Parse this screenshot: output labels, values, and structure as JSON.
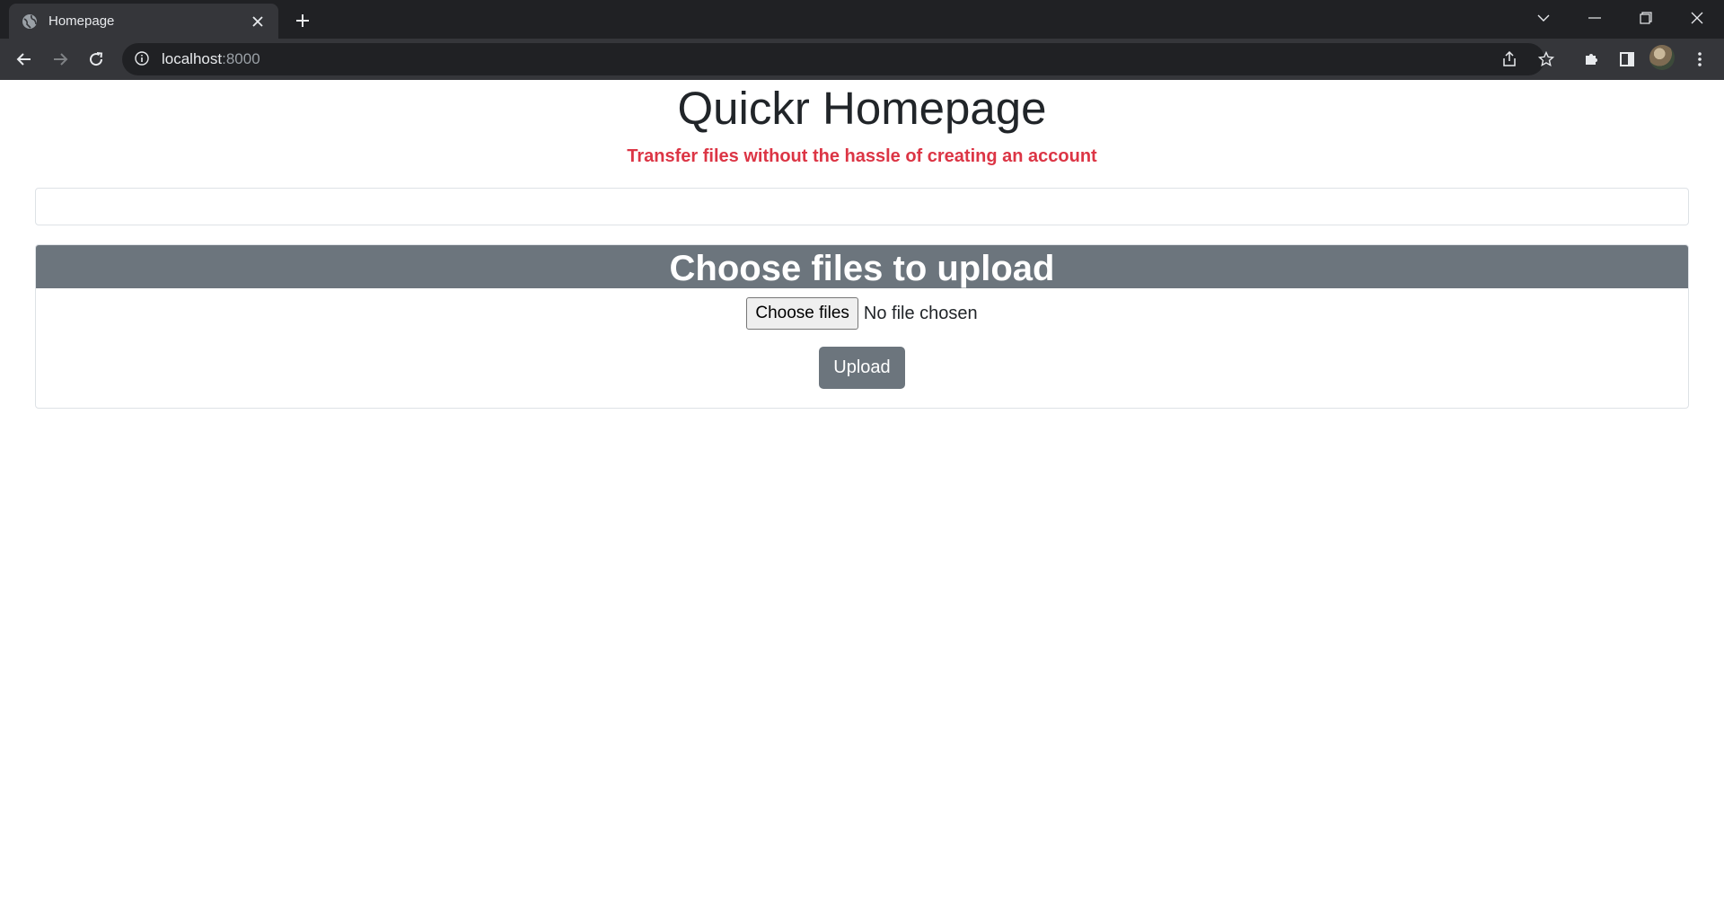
{
  "browser": {
    "tab": {
      "title": "Homepage"
    },
    "url": {
      "host": "localhost",
      "port": ":8000"
    }
  },
  "page": {
    "title": "Quickr Homepage",
    "subtitle": "Transfer files without the hassle of creating an account",
    "upload_card": {
      "header": "Choose files to upload",
      "choose_label": "Choose files",
      "no_file_text": "No file chosen",
      "upload_label": "Upload"
    }
  },
  "colors": {
    "accent_text": "#dc3545",
    "card_header": "#6c757d",
    "upload_button": "#6c757d"
  },
  "icons": [
    "globe-icon",
    "close-icon",
    "plus-icon",
    "back-icon",
    "forward-icon",
    "reload-icon",
    "info-icon",
    "share-icon",
    "star-icon",
    "puzzle-icon",
    "side-panel-icon",
    "menu-icon",
    "chevron-down-icon",
    "minimize-icon",
    "restore-icon",
    "window-close-icon"
  ]
}
